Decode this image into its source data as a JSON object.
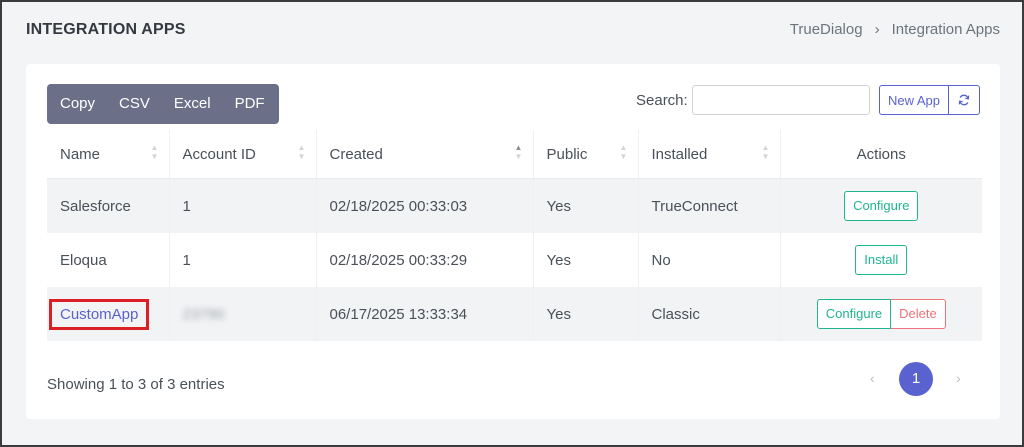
{
  "header": {
    "title": "INTEGRATION APPS",
    "breadcrumb": [
      "TrueDialog",
      "Integration Apps"
    ],
    "breadcrumb_separator": "›"
  },
  "toolbar": {
    "export_buttons": [
      "Copy",
      "CSV",
      "Excel",
      "PDF"
    ],
    "search_label": "Search:",
    "search_value": "",
    "new_app_label": "New App",
    "refresh_icon": "refresh-icon"
  },
  "table": {
    "columns": [
      "Name",
      "Account ID",
      "Created",
      "Public",
      "Installed",
      "Actions"
    ],
    "sorted_column": "Created",
    "sort_direction": "ascending",
    "rows": [
      {
        "name": "Salesforce",
        "account_id": "1",
        "created": "02/18/2025 00:33:03",
        "public": "Yes",
        "installed": "TrueConnect",
        "actions": [
          "Configure"
        ]
      },
      {
        "name": "Eloqua",
        "account_id": "1",
        "created": "02/18/2025 00:33:29",
        "public": "Yes",
        "installed": "No",
        "actions": [
          "Install"
        ]
      },
      {
        "name": "CustomApp",
        "account_id": "23790",
        "created": "06/17/2025 13:33:34",
        "public": "Yes",
        "installed": "Classic",
        "actions": [
          "Configure",
          "Delete"
        ]
      }
    ]
  },
  "footer": {
    "showing_text": "Showing 1 to 3 of 3 entries",
    "pagination": {
      "prev": "‹",
      "current_page": "1",
      "next": "›"
    }
  },
  "colors": {
    "accent": "#5a62d0",
    "export_group": "#6b7088",
    "success": "#1fb58f",
    "danger": "#f0727a",
    "highlight_box": "#dc1f26"
  }
}
